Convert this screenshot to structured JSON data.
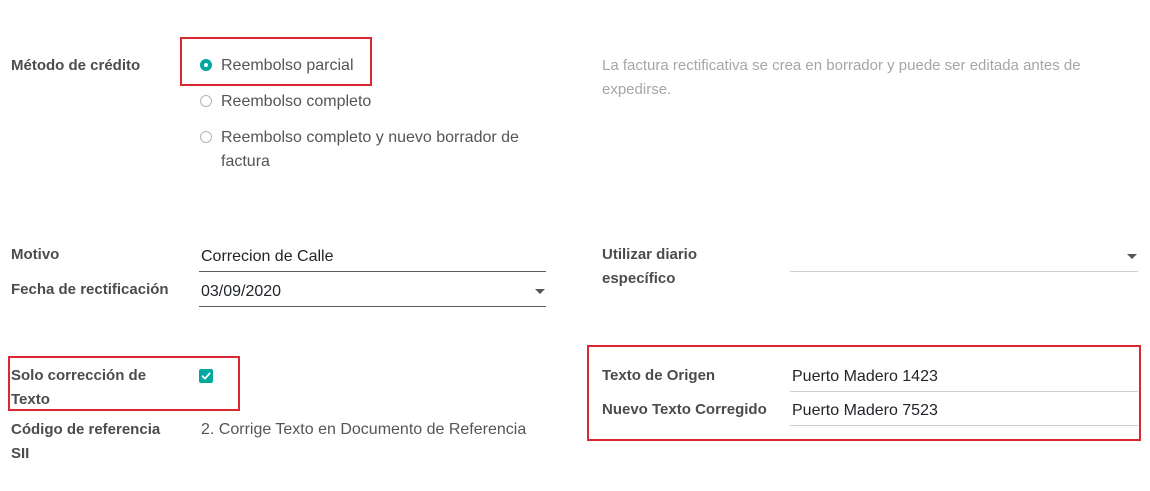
{
  "credit_method": {
    "label": "Método de crédito",
    "options": [
      {
        "label": "Reembolso parcial",
        "checked": true
      },
      {
        "label": "Reembolso completo",
        "checked": false
      },
      {
        "label_line1": "Reembolso completo y nuevo borrador de",
        "label_line2": "factura",
        "checked": false
      }
    ],
    "help_line1": "La factura rectificativa se crea en borrador y puede ser editada antes de",
    "help_line2": "expedirse."
  },
  "reason": {
    "label": "Motivo",
    "value": "Correcion de Calle"
  },
  "rectification_date": {
    "label": "Fecha de rectificación",
    "value": "03/09/2020"
  },
  "journal": {
    "label_line1": "Utilizar diario",
    "label_line2": "específico",
    "value": ""
  },
  "text_correction": {
    "label_line1": "Solo corrección de",
    "label_line2": "Texto",
    "checked": true
  },
  "sii_reference": {
    "label_line1": "Código de referencia",
    "label_line2": "SII",
    "value": "2. Corrige Texto en Documento de Referencia"
  },
  "origin_text": {
    "label": "Texto de Origen",
    "value": "Puerto Madero 1423"
  },
  "corrected_text": {
    "label": "Nuevo Texto Corregido",
    "value": "Puerto Madero 7523"
  },
  "colors": {
    "accent": "#01a89e",
    "highlight_box": "#d9282f"
  }
}
